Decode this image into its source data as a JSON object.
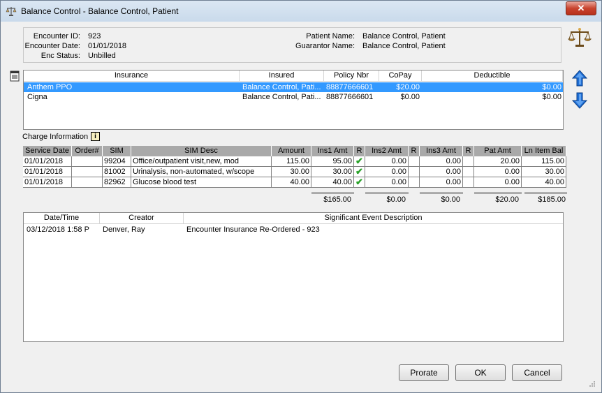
{
  "window": {
    "title": "Balance Control - Balance Control, Patient",
    "close_label": "✕"
  },
  "encounter": {
    "id_label": "Encounter ID:",
    "id_value": "923",
    "date_label": "Encounter Date:",
    "date_value": "01/01/2018",
    "status_label": "Enc Status:",
    "status_value": "Unbilled",
    "patient_label": "Patient Name:",
    "patient_value": "Balance Control, Patient",
    "guarantor_label": "Guarantor Name:",
    "guarantor_value": "Balance Control, Patient"
  },
  "insurance": {
    "headers": [
      "Insurance",
      "Insured",
      "Policy Nbr",
      "CoPay",
      "Deductible"
    ],
    "rows": [
      {
        "insurance": "Anthem PPO",
        "insured": "Balance Control, Pati...",
        "policy": "88877666601",
        "copay": "$20.00",
        "deductible": "$0.00",
        "selected": true
      },
      {
        "insurance": "Cigna",
        "insured": "Balance Control, Pati...",
        "policy": "88877666601",
        "copay": "$0.00",
        "deductible": "$0.00",
        "selected": false
      }
    ]
  },
  "charges": {
    "label": "Charge Information",
    "info_icon": "i",
    "headers": [
      "Service Date",
      "Order#",
      "SIM",
      "SIM Desc",
      "Amount",
      "Ins1 Amt",
      "R",
      "Ins2 Amt",
      "R",
      "Ins3 Amt",
      "R",
      "Pat Amt",
      "Ln Item Bal"
    ],
    "rows": [
      {
        "date": "01/01/2018",
        "order": "",
        "sim": "99204",
        "desc": "Office/outpatient visit,new, mod",
        "amount": "115.00",
        "ins1": "95.00",
        "ins2": "0.00",
        "ins3": "0.00",
        "pat": "20.00",
        "bal": "115.00"
      },
      {
        "date": "01/01/2018",
        "order": "",
        "sim": "81002",
        "desc": "Urinalysis, non-automated, w/scope",
        "amount": "30.00",
        "ins1": "30.00",
        "ins2": "0.00",
        "ins3": "0.00",
        "pat": "0.00",
        "bal": "30.00"
      },
      {
        "date": "01/01/2018",
        "order": "",
        "sim": "82962",
        "desc": "Glucose blood test",
        "amount": "40.00",
        "ins1": "40.00",
        "ins2": "0.00",
        "ins3": "0.00",
        "pat": "0.00",
        "bal": "40.00"
      }
    ],
    "check_glyph": "✔",
    "totals": {
      "ins1": "$165.00",
      "ins2": "$0.00",
      "ins3": "$0.00",
      "pat": "$20.00",
      "bal": "$185.00"
    }
  },
  "events": {
    "headers": [
      "Date/Time",
      "Creator",
      "Significant Event Description"
    ],
    "rows": [
      {
        "datetime": "03/12/2018 1:58 P",
        "creator": "Denver, Ray",
        "description": "Encounter Insurance Re-Ordered - 923"
      }
    ]
  },
  "buttons": {
    "prorate": "Prorate",
    "ok": "OK",
    "cancel": "Cancel"
  },
  "icons": {
    "title": "scales-icon",
    "header_right": "scales-icon",
    "side": "notepad-icon",
    "move_up": "arrow-up-icon",
    "move_down": "arrow-down-icon"
  },
  "colors": {
    "selection": "#3399ff",
    "grid_header": "#a9a9a9",
    "arrow_blue": "#1f6fd6",
    "check_green": "#2aa22a"
  }
}
